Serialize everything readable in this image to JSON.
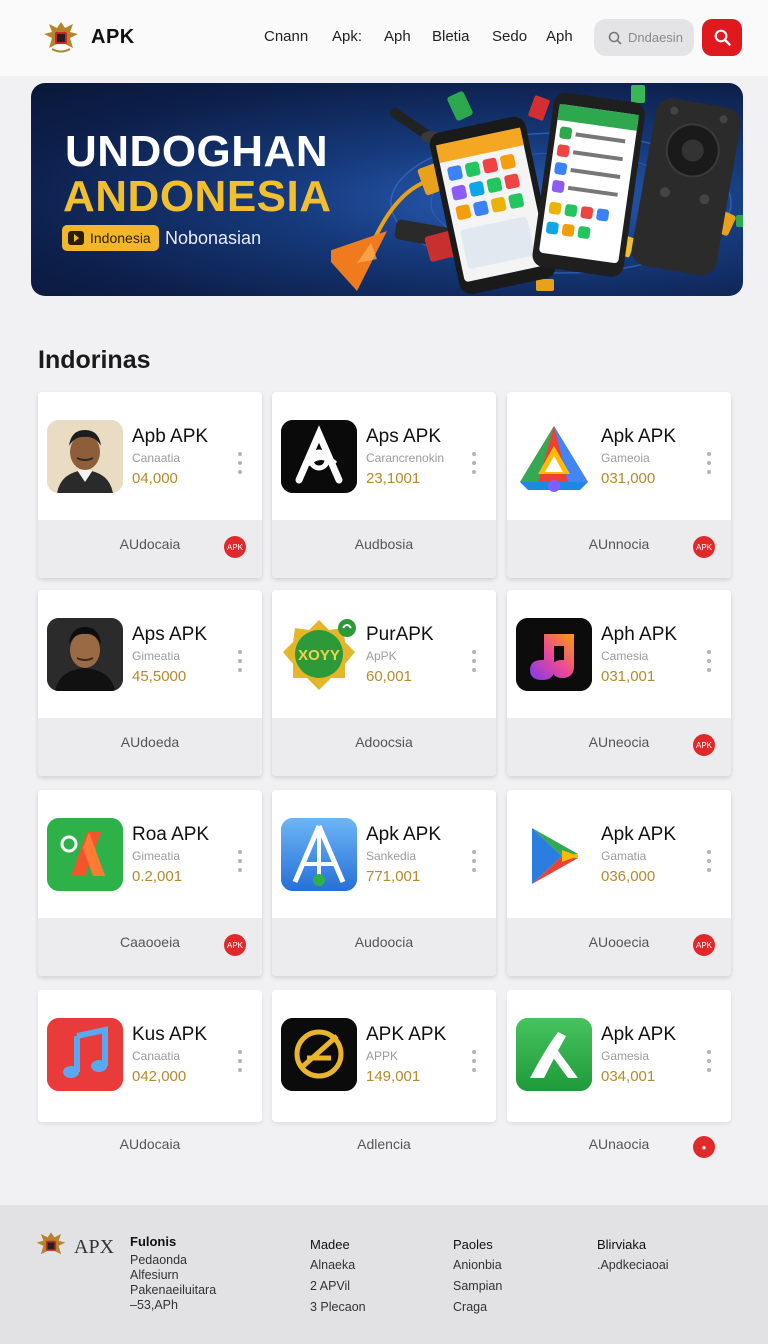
{
  "header": {
    "logo_text": "APK",
    "nav": [
      "Cnann",
      "Apk:",
      "Aph",
      "Bletia",
      "Sedo",
      "Aph"
    ],
    "search_placeholder": "Dndaesin"
  },
  "banner": {
    "title_line1": "UNDOGHAN",
    "title_line2": "ANDONESIA",
    "pill_label": "Indonesia",
    "subtitle": "Nobonasian",
    "colors": {
      "background": "#0f2557",
      "title": "#ffffff",
      "accent": "#f2c02e"
    }
  },
  "section": {
    "title": "Indorinas"
  },
  "apps": [
    {
      "name": "Apb APK",
      "category": "Canaatia",
      "downloads": "04,000",
      "footer_label": "AUdocaia",
      "badge": "APK",
      "icon": "person-photo-icon"
    },
    {
      "name": "Aps APK",
      "category": "Carancrenokin",
      "downloads": "23,1001",
      "footer_label": "Audbosia",
      "badge": "",
      "icon": "abstract-a-black-icon"
    },
    {
      "name": "Apk APK",
      "category": "Gameoia",
      "downloads": "031,000",
      "footer_label": "AUnnocia",
      "badge": "APK",
      "icon": "google-drive-style-icon"
    },
    {
      "name": "Aps APK",
      "category": "Gimeatia",
      "downloads": "45,5000",
      "footer_label": "AUdoeda",
      "badge": "",
      "icon": "person-photo-icon"
    },
    {
      "name": "PurAPK",
      "category": "ApPK",
      "downloads": "60,001",
      "footer_label": "Adoocsia",
      "badge": "",
      "icon": "gold-badge-icon"
    },
    {
      "name": "Aph APK",
      "category": "Camesia",
      "downloads": "031,001",
      "footer_label": "AUneocia",
      "badge": "APK",
      "icon": "music-gradient-icon"
    },
    {
      "name": "Roa APK",
      "category": "Gimeatia",
      "downloads": "0.2,001",
      "footer_label": "Caaooeia",
      "badge": "APK",
      "icon": "green-a-icon"
    },
    {
      "name": "Apk APK",
      "category": "Sankedia",
      "downloads": "771,001",
      "footer_label": "Audoocia",
      "badge": "",
      "icon": "blue-tower-icon"
    },
    {
      "name": "Apk APK",
      "category": "Gamatia",
      "downloads": "036,000",
      "footer_label": "AUooecia",
      "badge": "APK",
      "icon": "play-triangle-icon"
    },
    {
      "name": "Kus APK",
      "category": "Canaatia",
      "downloads": "042,000",
      "footer_label": "AUdocaia",
      "badge": "",
      "icon": "red-music-icon"
    },
    {
      "name": "APK APK",
      "category": "APPK",
      "downloads": "149,001",
      "footer_label": "Adlencia",
      "badge": "",
      "icon": "gold-circle-icon"
    },
    {
      "name": "Apk APK",
      "category": "Gamesia",
      "downloads": "034,001",
      "footer_label": "AUnaocia",
      "badge": "●",
      "icon": "green-arrow-icon"
    }
  ],
  "footer": {
    "brand": "APX",
    "col1": {
      "heading": "Fulonis",
      "lines": [
        "Pedaonda",
        "Alfesiurn",
        "Pakenaeiluitara",
        "–53,APh"
      ]
    },
    "col2": {
      "heading": "Madee",
      "lines": [
        "Alnaeka",
        "2 APVil",
        "3 Plecaon"
      ]
    },
    "col3": {
      "heading": "Paoles",
      "lines": [
        "Anionbia",
        "Sampian",
        "Craga"
      ]
    },
    "col4": {
      "heading": "Blirviaka",
      "lines": [
        ".Apdkeciaoai"
      ]
    }
  }
}
